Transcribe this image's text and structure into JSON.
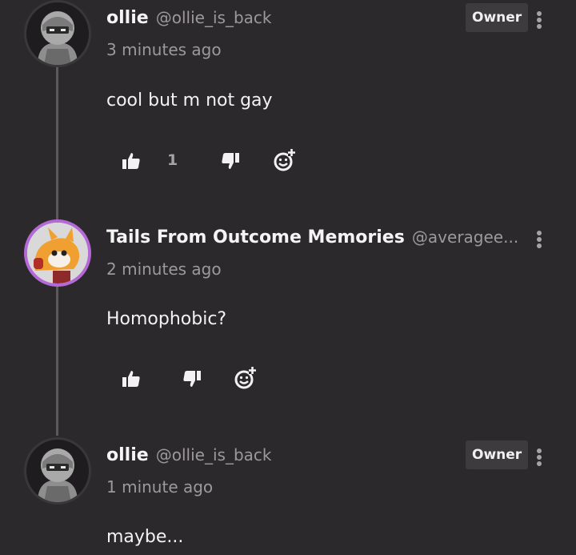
{
  "comments": [
    {
      "name": "ollie",
      "handle": "@ollie_is_back",
      "time": "3 minutes ago",
      "badge": "Owner",
      "text": "cool but m not gay",
      "likes": "1",
      "avatar_icon": "hooded-character-avatar"
    },
    {
      "name": "Tails From Outcome Memories",
      "handle": "@averagee...",
      "time": "2 minutes ago",
      "text": "Homophobic?",
      "avatar_icon": "fox-character-avatar"
    },
    {
      "name": "ollie",
      "handle": "@ollie_is_back",
      "time": "1 minute ago",
      "badge": "Owner",
      "text": "maybe...",
      "avatar_icon": "hooded-character-avatar"
    }
  ],
  "icons": {
    "like": "thumbs-up-icon",
    "dislike": "thumbs-down-icon",
    "reply": "add-reaction-icon",
    "more": "more-options-icon"
  },
  "colors": {
    "background": "#2c292c",
    "thread_line": "#5c595c",
    "secondary_text": "#9c999c",
    "badge_bg": "#3e3b3e",
    "avatar_ring": "#b569d6"
  }
}
